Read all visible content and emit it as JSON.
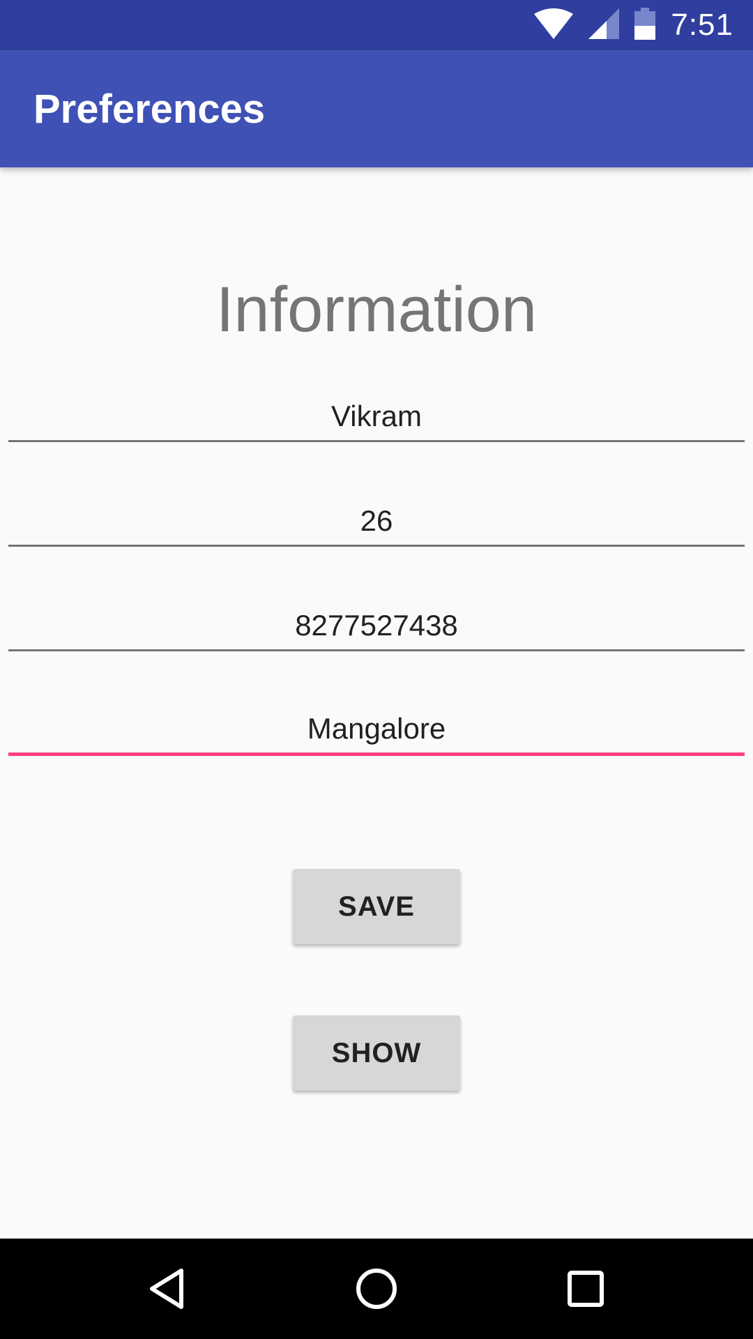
{
  "status_bar": {
    "time": "7:51",
    "icons": [
      "wifi-icon",
      "cellular-signal-icon",
      "battery-icon"
    ]
  },
  "app_bar": {
    "title": "Preferences"
  },
  "content": {
    "heading": "Information",
    "fields": [
      {
        "name": "name",
        "value": "Vikram"
      },
      {
        "name": "age",
        "value": "26"
      },
      {
        "name": "phone",
        "value": "8277527438"
      },
      {
        "name": "city",
        "value": "Mangalore",
        "focused": true
      }
    ],
    "buttons": {
      "save_label": "SAVE",
      "show_label": "SHOW"
    }
  },
  "nav_bar": {
    "icons": [
      "back-icon",
      "home-icon",
      "recents-icon"
    ]
  },
  "colors": {
    "status_bar": "#303f9f",
    "app_bar": "#3f51b5",
    "accent": "#ff4081",
    "background": "#fafafa",
    "button": "#d6d7d7"
  }
}
